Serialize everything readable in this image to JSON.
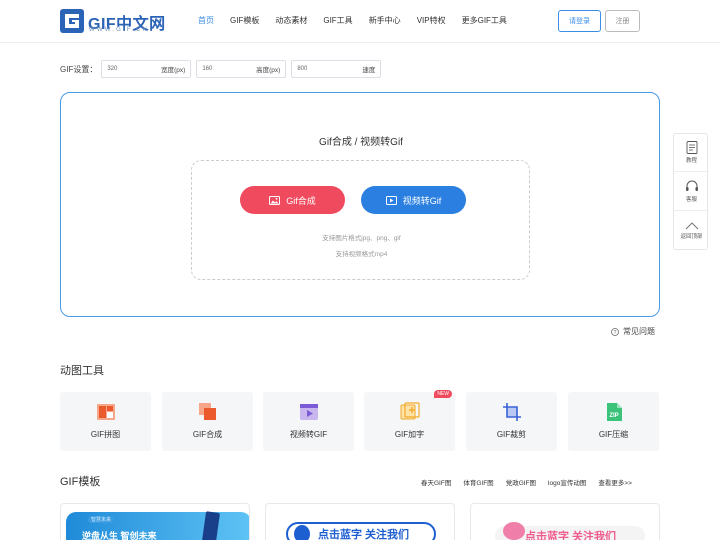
{
  "header": {
    "logo_text": "GIF中文网",
    "logo_sub": "WWW.GIF.CN",
    "nav": [
      "首页",
      "GIF模板",
      "动态素材",
      "GIF工具",
      "新手中心",
      "VIP特权",
      "更多GIF工具"
    ],
    "login": "请登录",
    "register": "注册"
  },
  "settings": {
    "label": "GIF设置：",
    "width_value": "320",
    "width_unit": "宽度(px)",
    "height_value": "160",
    "height_unit": "高度(px)",
    "speed_value": "800",
    "speed_unit": "速度"
  },
  "upload": {
    "title": "Gif合成 / 视频转Gif",
    "gif_button": "Gif合成",
    "video_button": "视频转Gif",
    "hint_image": "支持图片格式jpg、png、gif",
    "hint_video": "支持视频格式mp4"
  },
  "faq": "常见问题",
  "side": {
    "tutorial": "教程",
    "service": "客服",
    "top": "返回顶部"
  },
  "tools": {
    "title": "动图工具",
    "items": [
      "GIF拼图",
      "GIF合成",
      "视频转GIF",
      "GIF加字",
      "GIF裁剪",
      "GIF压缩"
    ],
    "new_badge": "NEW"
  },
  "templates": {
    "title": "GIF模板",
    "tags": [
      "春天GIF图",
      "体育GIF图",
      "党政GIF图",
      "logo宣传动图",
      "查看更多>>"
    ],
    "card1_small": "智慧未来",
    "card1_big": "逆盘从生 智创未来",
    "card2_text": "点击蓝字 关注我们",
    "card3_text": "点击蓝字 关注我们"
  },
  "colors": {
    "accent": "#3a8ee6",
    "gif_button": "#ef4a5e",
    "video_button": "#2a7fe0",
    "panel_border": "#4a9ae6"
  }
}
